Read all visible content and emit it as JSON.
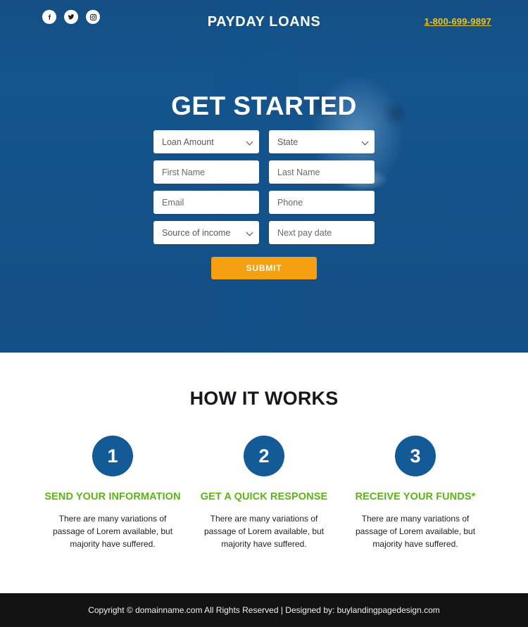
{
  "header": {
    "logo": "PAYDAY LOANS",
    "phone": "1-800-699-9897",
    "socials": [
      {
        "name": "facebook-icon",
        "label": "Facebook"
      },
      {
        "name": "twitter-icon",
        "label": "Twitter"
      },
      {
        "name": "instagram-icon",
        "label": "Instagram"
      }
    ]
  },
  "hero": {
    "title": "GET STARTED",
    "form": {
      "loan_amount": {
        "placeholder": "Loan Amount",
        "value": "Loan Amount",
        "type": "select"
      },
      "state": {
        "placeholder": "State",
        "value": "State",
        "type": "select"
      },
      "first_name": {
        "placeholder": "First Name",
        "value": "",
        "type": "text"
      },
      "last_name": {
        "placeholder": "Last Name",
        "value": "",
        "type": "text"
      },
      "email": {
        "placeholder": "Email",
        "value": "",
        "type": "text"
      },
      "phone": {
        "placeholder": "Phone",
        "value": "",
        "type": "text"
      },
      "source_of_income": {
        "placeholder": "Source of income",
        "value": "Source of income",
        "type": "select"
      },
      "next_pay_date": {
        "placeholder": "Next pay date",
        "value": "",
        "type": "text"
      },
      "submit_label": "SUBMIT"
    }
  },
  "works": {
    "title": "HOW IT WORKS",
    "steps": [
      {
        "number": "1",
        "title": "SEND YOUR INFORMATION",
        "desc": "There are many variations of passage of Lorem available, but majority have suffered."
      },
      {
        "number": "2",
        "title": "GET A QUICK RESPONSE",
        "desc": "There are many variations of passage of Lorem available, but majority have suffered."
      },
      {
        "number": "3",
        "title": "RECEIVE YOUR FUNDS*",
        "desc": "There are many variations of passage of Lorem available, but majority have suffered."
      }
    ]
  },
  "footer": {
    "text": "Copyright © domainname.com All Rights Reserved | Designed by: buylandingpagedesign.com"
  },
  "colors": {
    "hero_blue": "#15548c",
    "accent_orange": "#f5a010",
    "accent_green": "#5cb416",
    "phone_yellow": "#f2c516",
    "circle_blue": "#135b96",
    "footer_black": "#131313"
  }
}
